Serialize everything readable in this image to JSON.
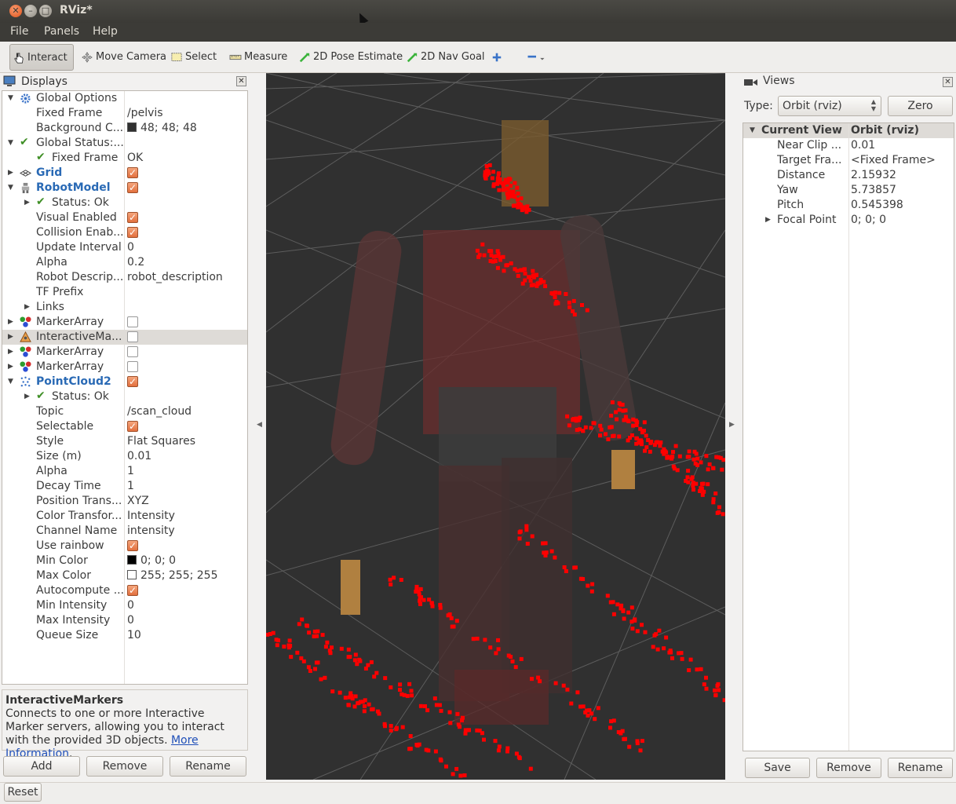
{
  "window": {
    "title": "RViz*"
  },
  "menu": [
    "File",
    "Panels",
    "Help"
  ],
  "toolbar": {
    "interact": "Interact",
    "move_camera": "Move Camera",
    "select": "Select",
    "measure": "Measure",
    "pose_estimate": "2D Pose Estimate",
    "nav_goal": "2D Nav Goal"
  },
  "displays": {
    "title": "Displays",
    "rows": {
      "global_options": "Global Options",
      "fixed_frame": {
        "label": "Fixed Frame",
        "value": "/pelvis"
      },
      "background": {
        "label": "Background C...",
        "value": "48; 48; 48",
        "color": "#303030"
      },
      "global_status": "Global Status:...",
      "gs_fixed_frame": {
        "label": "Fixed Frame",
        "value": "OK"
      },
      "grid": "Grid",
      "robot_model": "RobotModel",
      "rm_status": "Status: Ok",
      "visual_enabled": "Visual Enabled",
      "collision_enabled": "Collision Enab...",
      "update_interval": {
        "label": "Update Interval",
        "value": "0"
      },
      "alpha": {
        "label": "Alpha",
        "value": "0.2"
      },
      "robot_description": {
        "label": "Robot Descrip...",
        "value": "robot_description"
      },
      "tf_prefix": "TF Prefix",
      "links": "Links",
      "marker_array_1": "MarkerArray",
      "interactive_markers": "InteractiveMa...",
      "marker_array_2": "MarkerArray",
      "marker_array_3": "MarkerArray",
      "point_cloud": "PointCloud2",
      "pc_status": "Status: Ok",
      "topic": {
        "label": "Topic",
        "value": "/scan_cloud"
      },
      "selectable": "Selectable",
      "style": {
        "label": "Style",
        "value": "Flat Squares"
      },
      "size": {
        "label": "Size (m)",
        "value": "0.01"
      },
      "pc_alpha": {
        "label": "Alpha",
        "value": "1"
      },
      "decay_time": {
        "label": "Decay Time",
        "value": "1"
      },
      "position_transformer": {
        "label": "Position Trans...",
        "value": "XYZ"
      },
      "color_transformer": {
        "label": "Color Transfor...",
        "value": "Intensity"
      },
      "channel_name": {
        "label": "Channel Name",
        "value": "intensity"
      },
      "use_rainbow": "Use rainbow",
      "min_color": {
        "label": "Min Color",
        "value": "0; 0; 0",
        "color": "#000000"
      },
      "max_color": {
        "label": "Max Color",
        "value": "255; 255; 255",
        "color": "#ffffff"
      },
      "autocompute": "Autocompute ...",
      "min_intensity": {
        "label": "Min Intensity",
        "value": "0"
      },
      "max_intensity": {
        "label": "Max Intensity",
        "value": "0"
      },
      "queue_size": {
        "label": "Queue Size",
        "value": "10"
      }
    },
    "description": {
      "title": "InteractiveMarkers",
      "text": "Connects to one or more Interactive Marker servers, allowing you to interact with the provided 3D objects.",
      "link": "More Information"
    },
    "buttons": {
      "add": "Add",
      "remove": "Remove",
      "rename": "Rename"
    }
  },
  "views": {
    "title": "Views",
    "type_label": "Type:",
    "type_value": "Orbit (rviz)",
    "zero": "Zero",
    "current_view": {
      "label": "Current View",
      "value": "Orbit (rviz)"
    },
    "near_clip": {
      "label": "Near Clip ...",
      "value": "0.01"
    },
    "target_frame": {
      "label": "Target Fra...",
      "value": "<Fixed Frame>"
    },
    "distance": {
      "label": "Distance",
      "value": "2.15932"
    },
    "yaw": {
      "label": "Yaw",
      "value": "5.73857"
    },
    "pitch": {
      "label": "Pitch",
      "value": "0.545398"
    },
    "focal_point": {
      "label": "Focal Point",
      "value": "0; 0; 0"
    },
    "buttons": {
      "save": "Save",
      "remove": "Remove",
      "rename": "Rename"
    }
  },
  "status": {
    "reset": "Reset"
  },
  "colors": {
    "accent": "#e2703e",
    "point_cloud": "#ff0000",
    "viewport_bg": "#303030",
    "title_bar": "#3c3b37"
  }
}
